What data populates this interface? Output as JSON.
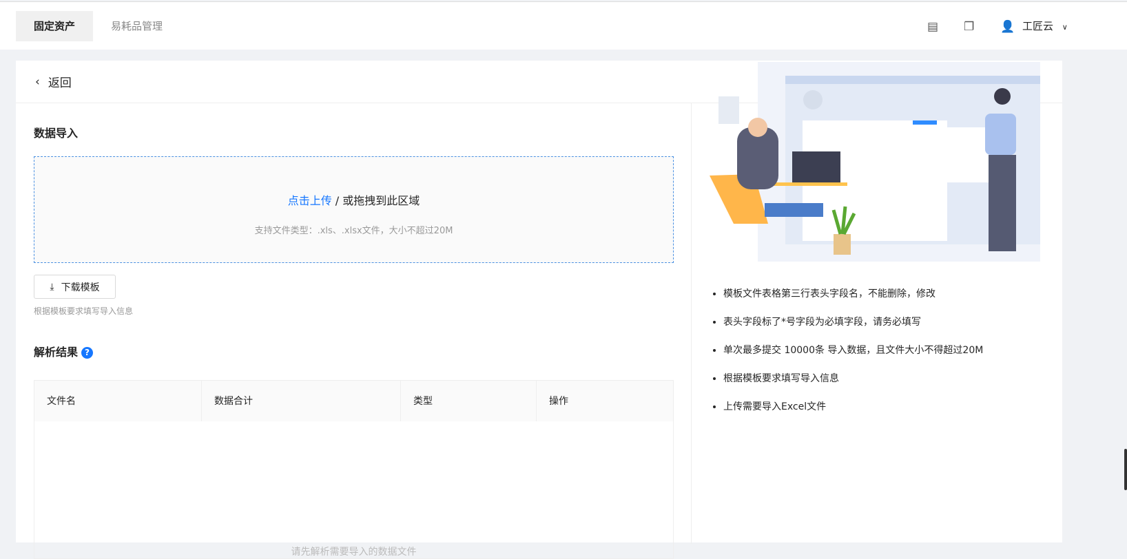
{
  "header": {
    "tabs": [
      {
        "label": "固定资产"
      },
      {
        "label": "易耗品管理"
      }
    ],
    "user": "工匠云"
  },
  "back_label": "返回",
  "import": {
    "title": "数据导入",
    "upload_link": "点击上传",
    "upload_rest": " / 或拖拽到此区域",
    "support": "支持文件类型：.xls、.xlsx文件，大小不超过20M",
    "download_btn": "下载模板",
    "hint": "根据模板要求填写导入信息"
  },
  "result": {
    "title": "解析结果",
    "help": "?",
    "columns": [
      "文件名",
      "数据合计",
      "类型",
      "操作"
    ],
    "empty": "请先解析需要导入的数据文件"
  },
  "tips": [
    "模板文件表格第三行表头字段名，不能删除，修改",
    "表头字段标了*号字段为必填字段，请务必填写",
    "单次最多提交 10000条 导入数据，且文件大小不得超过20M",
    "根据模板要求填写导入信息",
    "上传需要导入Excel文件"
  ]
}
